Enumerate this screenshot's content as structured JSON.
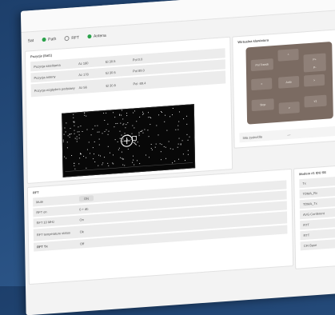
{
  "status": {
    "items": [
      {
        "label": "Sat",
        "state": "on"
      },
      {
        "label": "Path",
        "state": "on"
      },
      {
        "label": "RFT",
        "state": "off"
      },
      {
        "label": "Antena",
        "state": "on"
      }
    ]
  },
  "position_panel": {
    "title": "Pozycje (Sat1)",
    "rows": [
      {
        "name": "Pozycja satelitarna",
        "az": "Az 180",
        "el": "El 30.5",
        "pol": "Pol 0.0"
      },
      {
        "name": "Pozycja anteny",
        "az": "Az 178",
        "el": "El 30.5",
        "pol": "Pol 89.0"
      },
      {
        "name": "Pozycja względem podstawy",
        "az": "Az 56",
        "el": "El 30.5",
        "pol": "Pol -89.4"
      }
    ]
  },
  "keyboard_panel": {
    "title": "Wirtualna klawiatura",
    "keys": {
      "left_top": "Pol Tranck",
      "up": "^",
      "right_top": "P+",
      "left": "<",
      "center": "Auto",
      "right": ">",
      "right_mid": "P-",
      "stop": "Stop",
      "down": "v",
      "right_bottom": "v1"
    },
    "speed_label": "Siła zysku/dla",
    "speed_value": "—"
  },
  "rft_panel": {
    "title": "RFT",
    "rows": [
      {
        "label": "Mute",
        "value": "ON"
      },
      {
        "label": "RFT on",
        "value": "0  +  db"
      },
      {
        "label": "RFT 10 MHz",
        "value": "On"
      },
      {
        "label": "RFT temperature status",
        "value": "Ok"
      },
      {
        "label": "RFT Tx",
        "value": "Off"
      }
    ]
  },
  "modem_panel": {
    "title": "Modem #1 IDU SE",
    "rows": [
      "Tx",
      "TDMA_Rx",
      "TDMA_Tx",
      "AVG Conferent",
      "RTT",
      "RTT",
      "CFI Base"
    ]
  }
}
